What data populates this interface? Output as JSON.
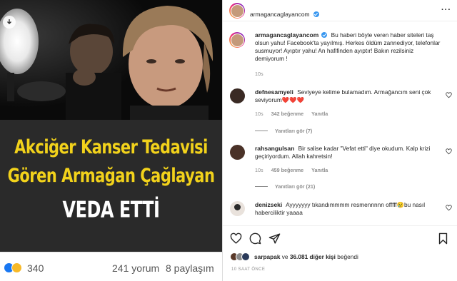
{
  "media": {
    "headline_line1": "Akciğer Kanser Tedavisi",
    "headline_line2": "Gören Armağan Çağlayan",
    "headline_line3": "VEDA ETTİ",
    "reaction_count": "340",
    "comments_count": "241 yorum",
    "shares_count": "8 paylaşım",
    "colors": {
      "headline_yellow": "#f2d21b",
      "banner_bg": "#2a2a2a"
    }
  },
  "post": {
    "author": "armagancaglayancom",
    "caption": "Bu haberi böyle veren haber siteleri taş olsun yahu! Facebook'ta yayılmış. Herkes öldüm zannediyor, telefonlar susmuyor! Ayıptır yahu! An hafifinden ayıptır! Bakın rezilsiniz demiyorum !",
    "caption_time": "10s"
  },
  "comments": [
    {
      "username": "defnesamyeli",
      "text": "Seviyeye kelime bulamadım. Armağancım seni çok seviyorum❤️❤️❤️",
      "time": "10s",
      "likes": "342 beğenme",
      "reply_label": "Yanıtla",
      "replies_label": "Yanıtları gör (7)"
    },
    {
      "username": "rahsangulsan",
      "text": "Bir salise kadar \"Vefat etti\" diye okudum. Kalp krizi geçiriyordum. Allah kahretsin!",
      "time": "10s",
      "likes": "459 beğenme",
      "reply_label": "Yanıtla",
      "replies_label": "Yanıtları gör (21)"
    },
    {
      "username": "denizseki",
      "text": "Ayyyyyyy tıkandımmmm resmennnnn offfff😢bu nasıl haberciliktir yaaaa"
    }
  ],
  "footer": {
    "likes_user": "sarpapak",
    "likes_connector": "ve",
    "likes_others": "36.081 diğer kişi",
    "likes_suffix": "beğendi",
    "timestamp": "10 SAAT ÖNCE"
  },
  "icons": [
    "download-icon",
    "verified-icon",
    "more-icon",
    "heart-icon",
    "comment-icon",
    "share-icon",
    "bookmark-icon"
  ]
}
